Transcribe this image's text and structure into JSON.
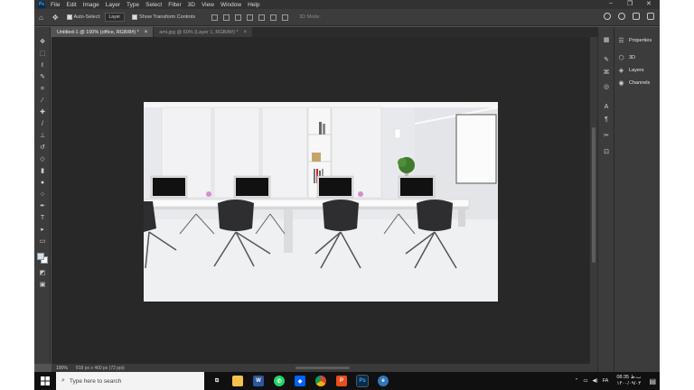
{
  "menu": {
    "logo": "Ps",
    "items": [
      "File",
      "Edit",
      "Image",
      "Layer",
      "Type",
      "Select",
      "Filter",
      "3D",
      "View",
      "Window",
      "Help"
    ],
    "window_controls": [
      "–",
      "❐",
      "✕"
    ]
  },
  "options_bar": {
    "auto_select_label": "Auto-Select:",
    "auto_select_target": "Layer",
    "transform_controls_label": "Show Transform Controls",
    "mode_3d_label": "3D Mode:"
  },
  "tabs": [
    {
      "label": "Untitled-1 @ 100% (office, RGB/8#) *",
      "active": true
    },
    {
      "label": "ami.jpg @ 60% (Layer 1, RGB/8#) *",
      "active": false
    }
  ],
  "panels": {
    "properties": "Properties",
    "three_d": "3D",
    "layers": "Layers",
    "channels": "Channels"
  },
  "status": {
    "zoom": "100%",
    "doc_info": "818 px x 460 px (72 ppi)"
  },
  "taskbar": {
    "search_placeholder": "Type here to search",
    "clock_time": "08:35 ب.ظ",
    "clock_date": "۱۴۰۰/۰۹/۰۳",
    "apps": [
      {
        "name": "task-view",
        "glyph": "⧉",
        "color": "#101010"
      },
      {
        "name": "file-explorer",
        "glyph": "",
        "color": "#f2c14e"
      },
      {
        "name": "word",
        "glyph": "W",
        "color": "#2b579a"
      },
      {
        "name": "whatsapp",
        "glyph": "✆",
        "color": "#25d366"
      },
      {
        "name": "dropbox",
        "glyph": "◆",
        "color": "#0061ff"
      },
      {
        "name": "chrome",
        "glyph": "●",
        "color": "#db4437"
      },
      {
        "name": "pdf-app",
        "glyph": "P",
        "color": "#e94e1b"
      },
      {
        "name": "photoshop",
        "glyph": "Ps",
        "color": "#0b2a4a"
      },
      {
        "name": "edge",
        "glyph": "e",
        "color": "#3277bc"
      }
    ]
  },
  "colors": {
    "ps_accent": "#31a8ff",
    "canvas_bg": "#282828",
    "panel_bg": "#3c3c3c"
  }
}
